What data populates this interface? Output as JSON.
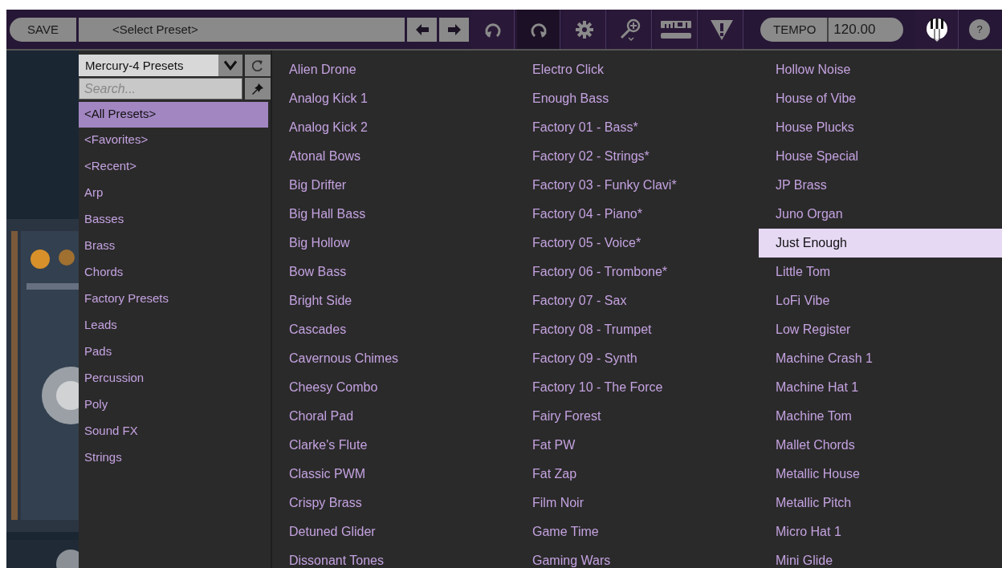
{
  "toolbar": {
    "save_label": "SAVE",
    "preset_field": "<Select Preset>",
    "tempo_label": "TEMPO",
    "tempo_value": "120.00",
    "help_label": "?"
  },
  "browser": {
    "bank": "Mercury-4 Presets",
    "search": {
      "placeholder": "Search..."
    },
    "categories": [
      {
        "label": "<All Presets>",
        "selected": true
      },
      {
        "label": "<Favorites>",
        "selected": false
      },
      {
        "label": "<Recent>",
        "selected": false
      },
      {
        "label": "Arp",
        "selected": false
      },
      {
        "label": "Basses",
        "selected": false
      },
      {
        "label": "Brass",
        "selected": false
      },
      {
        "label": "Chords",
        "selected": false
      },
      {
        "label": "Factory Presets",
        "selected": false
      },
      {
        "label": "Leads",
        "selected": false
      },
      {
        "label": "Pads",
        "selected": false
      },
      {
        "label": "Percussion",
        "selected": false
      },
      {
        "label": "Poly",
        "selected": false
      },
      {
        "label": "Sound FX",
        "selected": false
      },
      {
        "label": "Strings",
        "selected": false
      }
    ],
    "preset_columns": [
      [
        {
          "label": "Alien Drone",
          "selected": false
        },
        {
          "label": "Analog Kick 1",
          "selected": false
        },
        {
          "label": "Analog Kick 2",
          "selected": false
        },
        {
          "label": "Atonal Bows",
          "selected": false
        },
        {
          "label": "Big Drifter",
          "selected": false
        },
        {
          "label": "Big Hall Bass",
          "selected": false
        },
        {
          "label": "Big Hollow",
          "selected": false
        },
        {
          "label": "Bow Bass",
          "selected": false
        },
        {
          "label": "Bright Side",
          "selected": false
        },
        {
          "label": "Cascades",
          "selected": false
        },
        {
          "label": "Cavernous Chimes",
          "selected": false
        },
        {
          "label": "Cheesy Combo",
          "selected": false
        },
        {
          "label": "Choral Pad",
          "selected": false
        },
        {
          "label": "Clarke's Flute",
          "selected": false
        },
        {
          "label": "Classic PWM",
          "selected": false
        },
        {
          "label": "Crispy Brass",
          "selected": false
        },
        {
          "label": "Detuned Glider",
          "selected": false
        },
        {
          "label": "Dissonant Tones",
          "selected": false
        }
      ],
      [
        {
          "label": "Electro Click",
          "selected": false
        },
        {
          "label": "Enough Bass",
          "selected": false
        },
        {
          "label": "Factory 01 - Bass*",
          "selected": false
        },
        {
          "label": "Factory 02 - Strings*",
          "selected": false
        },
        {
          "label": "Factory 03 - Funky Clavi*",
          "selected": false
        },
        {
          "label": "Factory 04 - Piano*",
          "selected": false
        },
        {
          "label": "Factory 05 - Voice*",
          "selected": false
        },
        {
          "label": "Factory 06 - Trombone*",
          "selected": false
        },
        {
          "label": "Factory 07 - Sax",
          "selected": false
        },
        {
          "label": "Factory 08 - Trumpet",
          "selected": false
        },
        {
          "label": "Factory 09 - Synth",
          "selected": false
        },
        {
          "label": "Factory 10 - The Force",
          "selected": false
        },
        {
          "label": "Fairy Forest",
          "selected": false
        },
        {
          "label": "Fat PW",
          "selected": false
        },
        {
          "label": "Fat Zap",
          "selected": false
        },
        {
          "label": "Film Noir",
          "selected": false
        },
        {
          "label": "Game Time",
          "selected": false
        },
        {
          "label": "Gaming Wars",
          "selected": false
        }
      ],
      [
        {
          "label": "Hollow Noise",
          "selected": false
        },
        {
          "label": "House of Vibe",
          "selected": false
        },
        {
          "label": "House Plucks",
          "selected": false
        },
        {
          "label": "House Special",
          "selected": false
        },
        {
          "label": "JP Brass",
          "selected": false
        },
        {
          "label": "Juno Organ",
          "selected": false
        },
        {
          "label": "Just Enough",
          "selected": true
        },
        {
          "label": "Little Tom",
          "selected": false
        },
        {
          "label": "LoFi Vibe",
          "selected": false
        },
        {
          "label": "Low Register",
          "selected": false
        },
        {
          "label": "Machine Crash 1",
          "selected": false
        },
        {
          "label": "Machine Hat 1",
          "selected": false
        },
        {
          "label": "Machine Tom",
          "selected": false
        },
        {
          "label": "Mallet Chords",
          "selected": false
        },
        {
          "label": "Metallic House",
          "selected": false
        },
        {
          "label": "Metallic Pitch",
          "selected": false
        },
        {
          "label": "Micro Hat 1",
          "selected": false
        },
        {
          "label": "Mini Glide",
          "selected": false
        }
      ]
    ]
  }
}
